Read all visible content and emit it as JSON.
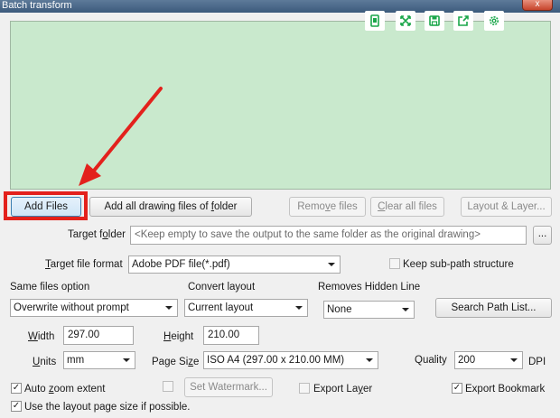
{
  "window": {
    "title": "Batch transform",
    "close_glyph": "x"
  },
  "toolbar_icons": [
    "save-page-icon",
    "expand-icon",
    "floppy-icon",
    "share-icon",
    "settings-icon"
  ],
  "files": {
    "add_files": "Add Files",
    "add_all": "Add all drawing files of folder",
    "remove": "Remove files",
    "clear": "Clear all files",
    "layout": "Layout & Layer..."
  },
  "target": {
    "folder_label": "Target folder",
    "folder_placeholder": "<Keep empty to save the output to the same folder as the original drawing>",
    "browse": "...",
    "format_label": "Target file format",
    "format_value": "Adobe PDF file(*.pdf)",
    "keep_subpath": "Keep sub-path structure"
  },
  "options": {
    "same_files_label": "Same files option",
    "same_files_value": "Overwrite without prompt",
    "convert_layout_label": "Convert layout",
    "convert_layout_value": "Current layout",
    "hidden_line_label": "Removes Hidden Line",
    "hidden_line_value": "None",
    "search_path": "Search Path List..."
  },
  "size": {
    "width_label": "Width",
    "width_value": "297.00",
    "height_label": "Height",
    "height_value": "210.00",
    "units_label": "Units",
    "units_value": "mm",
    "page_size_label": "Page Size",
    "page_size_value": "ISO A4 (297.00 x 210.00 MM)",
    "quality_label": "Quality",
    "quality_value": "200",
    "dpi_label": "DPI"
  },
  "checks": {
    "auto_zoom": "Auto zoom extent",
    "set_watermark": "Set Watermark...",
    "export_layer": "Export Layer",
    "export_bookmark": "Export Bookmark",
    "use_layout_size": "Use the layout page size if possible."
  },
  "colors": {
    "preview_bg": "#c9e9cd",
    "icon_green": "#1aa64a",
    "annotation_red": "#e3211c"
  }
}
